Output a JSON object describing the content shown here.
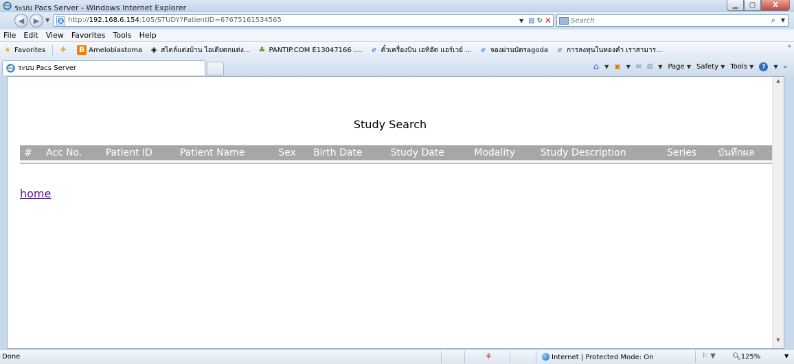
{
  "window": {
    "title": "ระบบ Pacs Server - Windows Internet Explorer",
    "minimize": "▁",
    "maximize": "▢",
    "close": "X"
  },
  "address": {
    "url_prefix": "http://",
    "url_host": "192.168.6.154",
    "url_rest": ":105/STUDY?PatientID=67675161534565",
    "search_placeholder": "Search"
  },
  "menu": [
    "File",
    "Edit",
    "View",
    "Favorites",
    "Tools",
    "Help"
  ],
  "favorites_bar": {
    "favorites_label": "Favorites",
    "items": [
      "Ameloblastoma",
      "สไตล์แต่งบ้าน ไอเดียตกแต่ง...",
      "PANTIP.COM E13047166 ....",
      "ตั๋วเครื่องบิน เอทิฮัด แอร์เวย์ ...",
      "จองผ่านบัตรagoda",
      "การลงทุนในทองคำ เราสามาร..."
    ]
  },
  "tab": {
    "label": "ระบบ Pacs Server"
  },
  "command_bar": {
    "page": "Page",
    "safety": "Safety",
    "tools": "Tools"
  },
  "page": {
    "title": "Study Search",
    "columns": [
      "#",
      "Acc No.",
      "Patient ID",
      "Patient Name",
      "Sex",
      "Birth Date",
      "Study Date",
      "Modality",
      "Study Description",
      "Series",
      "บันทึกผล"
    ],
    "home_link": "home"
  },
  "status": {
    "text": "Done",
    "zone": "Internet | Protected Mode: On",
    "zoom": "125%"
  }
}
